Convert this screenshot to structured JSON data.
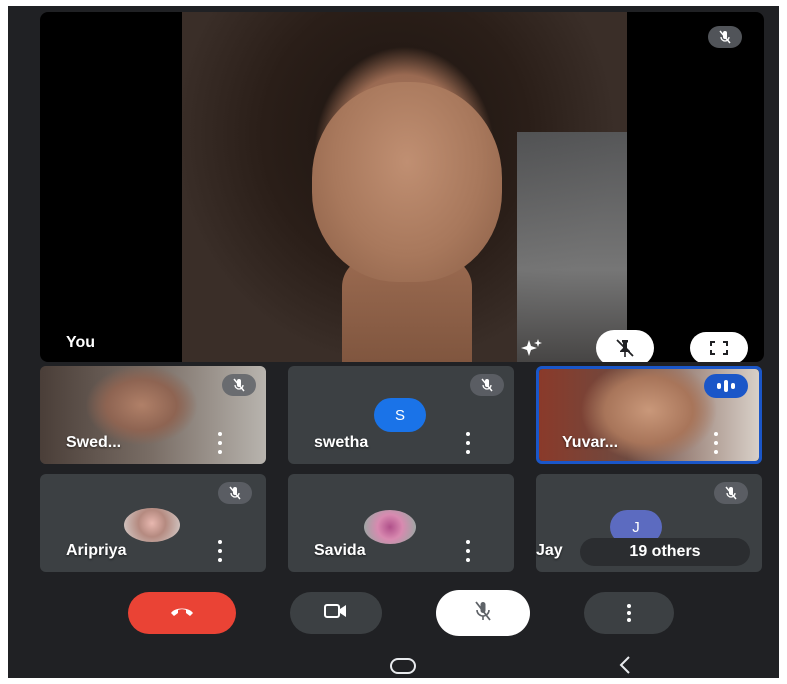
{
  "main": {
    "label": "You",
    "mic_icon": "mic-off-icon",
    "effects_icon": "sparkle-icon",
    "pin_icon": "unpin-icon",
    "fullscreen_icon": "fullscreen-icon"
  },
  "participants": [
    {
      "name": "Swed...",
      "avatar": "video",
      "muted": true
    },
    {
      "name": "swetha",
      "avatar": "letter",
      "initial": "S",
      "avatar_color": "#1a73e8",
      "muted": true
    },
    {
      "name": "Yuvar...",
      "avatar": "video",
      "speaking": true,
      "highlight_color": "#1a56c8"
    },
    {
      "name": "Aripriya",
      "avatar": "photo",
      "muted": true
    },
    {
      "name": "Savida",
      "avatar": "photo",
      "muted": false
    },
    {
      "name": "Jay",
      "avatar": "letter",
      "initial": "J",
      "avatar_color": "#5c6bc0",
      "muted": true
    }
  ],
  "others_chip": "19 others",
  "controls": {
    "end_call_icon": "end-call-icon",
    "end_call_color": "#ea4335",
    "camera_icon": "camera-icon",
    "mic_icon": "mic-off-icon",
    "more_icon": "more-vert-icon"
  },
  "navbar": {
    "home_icon": "home-icon",
    "back_icon": "back-icon"
  }
}
